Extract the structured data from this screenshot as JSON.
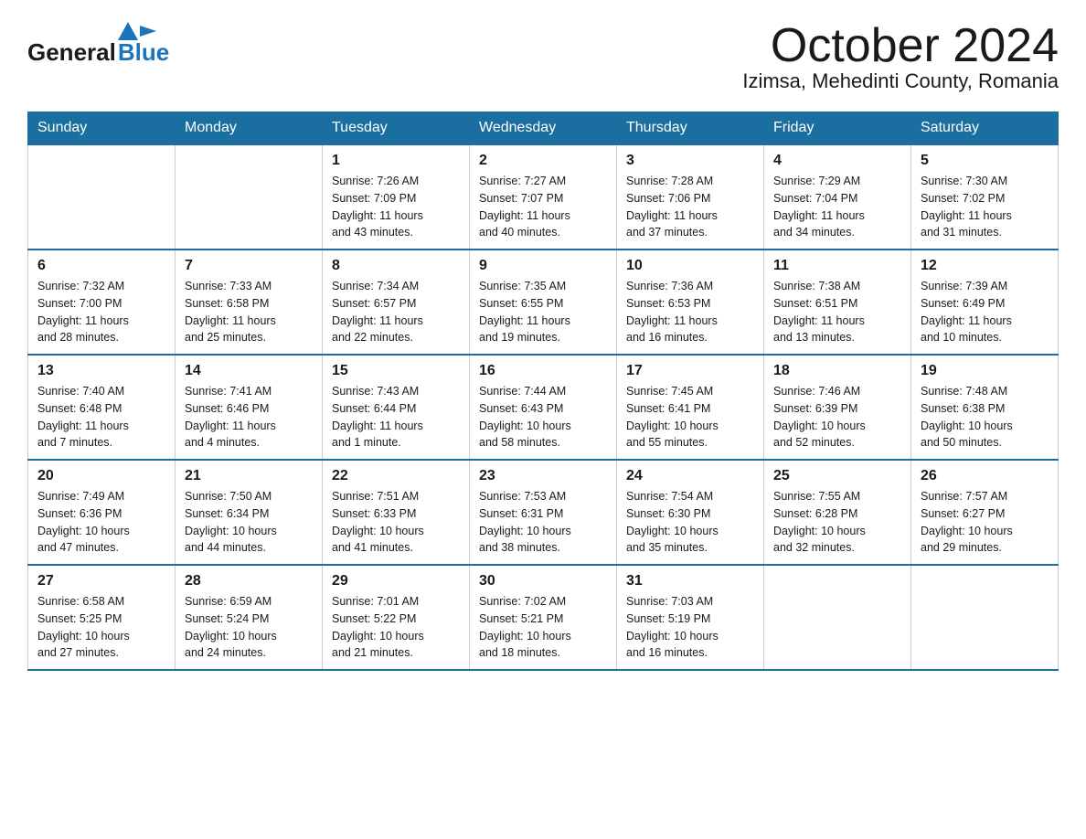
{
  "header": {
    "logo": {
      "general": "General",
      "blue": "Blue"
    },
    "month_year": "October 2024",
    "location": "Izimsa, Mehedinti County, Romania"
  },
  "days_of_week": [
    "Sunday",
    "Monday",
    "Tuesday",
    "Wednesday",
    "Thursday",
    "Friday",
    "Saturday"
  ],
  "weeks": [
    [
      {
        "day": "",
        "info": ""
      },
      {
        "day": "",
        "info": ""
      },
      {
        "day": "1",
        "info": "Sunrise: 7:26 AM\nSunset: 7:09 PM\nDaylight: 11 hours\nand 43 minutes."
      },
      {
        "day": "2",
        "info": "Sunrise: 7:27 AM\nSunset: 7:07 PM\nDaylight: 11 hours\nand 40 minutes."
      },
      {
        "day": "3",
        "info": "Sunrise: 7:28 AM\nSunset: 7:06 PM\nDaylight: 11 hours\nand 37 minutes."
      },
      {
        "day": "4",
        "info": "Sunrise: 7:29 AM\nSunset: 7:04 PM\nDaylight: 11 hours\nand 34 minutes."
      },
      {
        "day": "5",
        "info": "Sunrise: 7:30 AM\nSunset: 7:02 PM\nDaylight: 11 hours\nand 31 minutes."
      }
    ],
    [
      {
        "day": "6",
        "info": "Sunrise: 7:32 AM\nSunset: 7:00 PM\nDaylight: 11 hours\nand 28 minutes."
      },
      {
        "day": "7",
        "info": "Sunrise: 7:33 AM\nSunset: 6:58 PM\nDaylight: 11 hours\nand 25 minutes."
      },
      {
        "day": "8",
        "info": "Sunrise: 7:34 AM\nSunset: 6:57 PM\nDaylight: 11 hours\nand 22 minutes."
      },
      {
        "day": "9",
        "info": "Sunrise: 7:35 AM\nSunset: 6:55 PM\nDaylight: 11 hours\nand 19 minutes."
      },
      {
        "day": "10",
        "info": "Sunrise: 7:36 AM\nSunset: 6:53 PM\nDaylight: 11 hours\nand 16 minutes."
      },
      {
        "day": "11",
        "info": "Sunrise: 7:38 AM\nSunset: 6:51 PM\nDaylight: 11 hours\nand 13 minutes."
      },
      {
        "day": "12",
        "info": "Sunrise: 7:39 AM\nSunset: 6:49 PM\nDaylight: 11 hours\nand 10 minutes."
      }
    ],
    [
      {
        "day": "13",
        "info": "Sunrise: 7:40 AM\nSunset: 6:48 PM\nDaylight: 11 hours\nand 7 minutes."
      },
      {
        "day": "14",
        "info": "Sunrise: 7:41 AM\nSunset: 6:46 PM\nDaylight: 11 hours\nand 4 minutes."
      },
      {
        "day": "15",
        "info": "Sunrise: 7:43 AM\nSunset: 6:44 PM\nDaylight: 11 hours\nand 1 minute."
      },
      {
        "day": "16",
        "info": "Sunrise: 7:44 AM\nSunset: 6:43 PM\nDaylight: 10 hours\nand 58 minutes."
      },
      {
        "day": "17",
        "info": "Sunrise: 7:45 AM\nSunset: 6:41 PM\nDaylight: 10 hours\nand 55 minutes."
      },
      {
        "day": "18",
        "info": "Sunrise: 7:46 AM\nSunset: 6:39 PM\nDaylight: 10 hours\nand 52 minutes."
      },
      {
        "day": "19",
        "info": "Sunrise: 7:48 AM\nSunset: 6:38 PM\nDaylight: 10 hours\nand 50 minutes."
      }
    ],
    [
      {
        "day": "20",
        "info": "Sunrise: 7:49 AM\nSunset: 6:36 PM\nDaylight: 10 hours\nand 47 minutes."
      },
      {
        "day": "21",
        "info": "Sunrise: 7:50 AM\nSunset: 6:34 PM\nDaylight: 10 hours\nand 44 minutes."
      },
      {
        "day": "22",
        "info": "Sunrise: 7:51 AM\nSunset: 6:33 PM\nDaylight: 10 hours\nand 41 minutes."
      },
      {
        "day": "23",
        "info": "Sunrise: 7:53 AM\nSunset: 6:31 PM\nDaylight: 10 hours\nand 38 minutes."
      },
      {
        "day": "24",
        "info": "Sunrise: 7:54 AM\nSunset: 6:30 PM\nDaylight: 10 hours\nand 35 minutes."
      },
      {
        "day": "25",
        "info": "Sunrise: 7:55 AM\nSunset: 6:28 PM\nDaylight: 10 hours\nand 32 minutes."
      },
      {
        "day": "26",
        "info": "Sunrise: 7:57 AM\nSunset: 6:27 PM\nDaylight: 10 hours\nand 29 minutes."
      }
    ],
    [
      {
        "day": "27",
        "info": "Sunrise: 6:58 AM\nSunset: 5:25 PM\nDaylight: 10 hours\nand 27 minutes."
      },
      {
        "day": "28",
        "info": "Sunrise: 6:59 AM\nSunset: 5:24 PM\nDaylight: 10 hours\nand 24 minutes."
      },
      {
        "day": "29",
        "info": "Sunrise: 7:01 AM\nSunset: 5:22 PM\nDaylight: 10 hours\nand 21 minutes."
      },
      {
        "day": "30",
        "info": "Sunrise: 7:02 AM\nSunset: 5:21 PM\nDaylight: 10 hours\nand 18 minutes."
      },
      {
        "day": "31",
        "info": "Sunrise: 7:03 AM\nSunset: 5:19 PM\nDaylight: 10 hours\nand 16 minutes."
      },
      {
        "day": "",
        "info": ""
      },
      {
        "day": "",
        "info": ""
      }
    ]
  ]
}
